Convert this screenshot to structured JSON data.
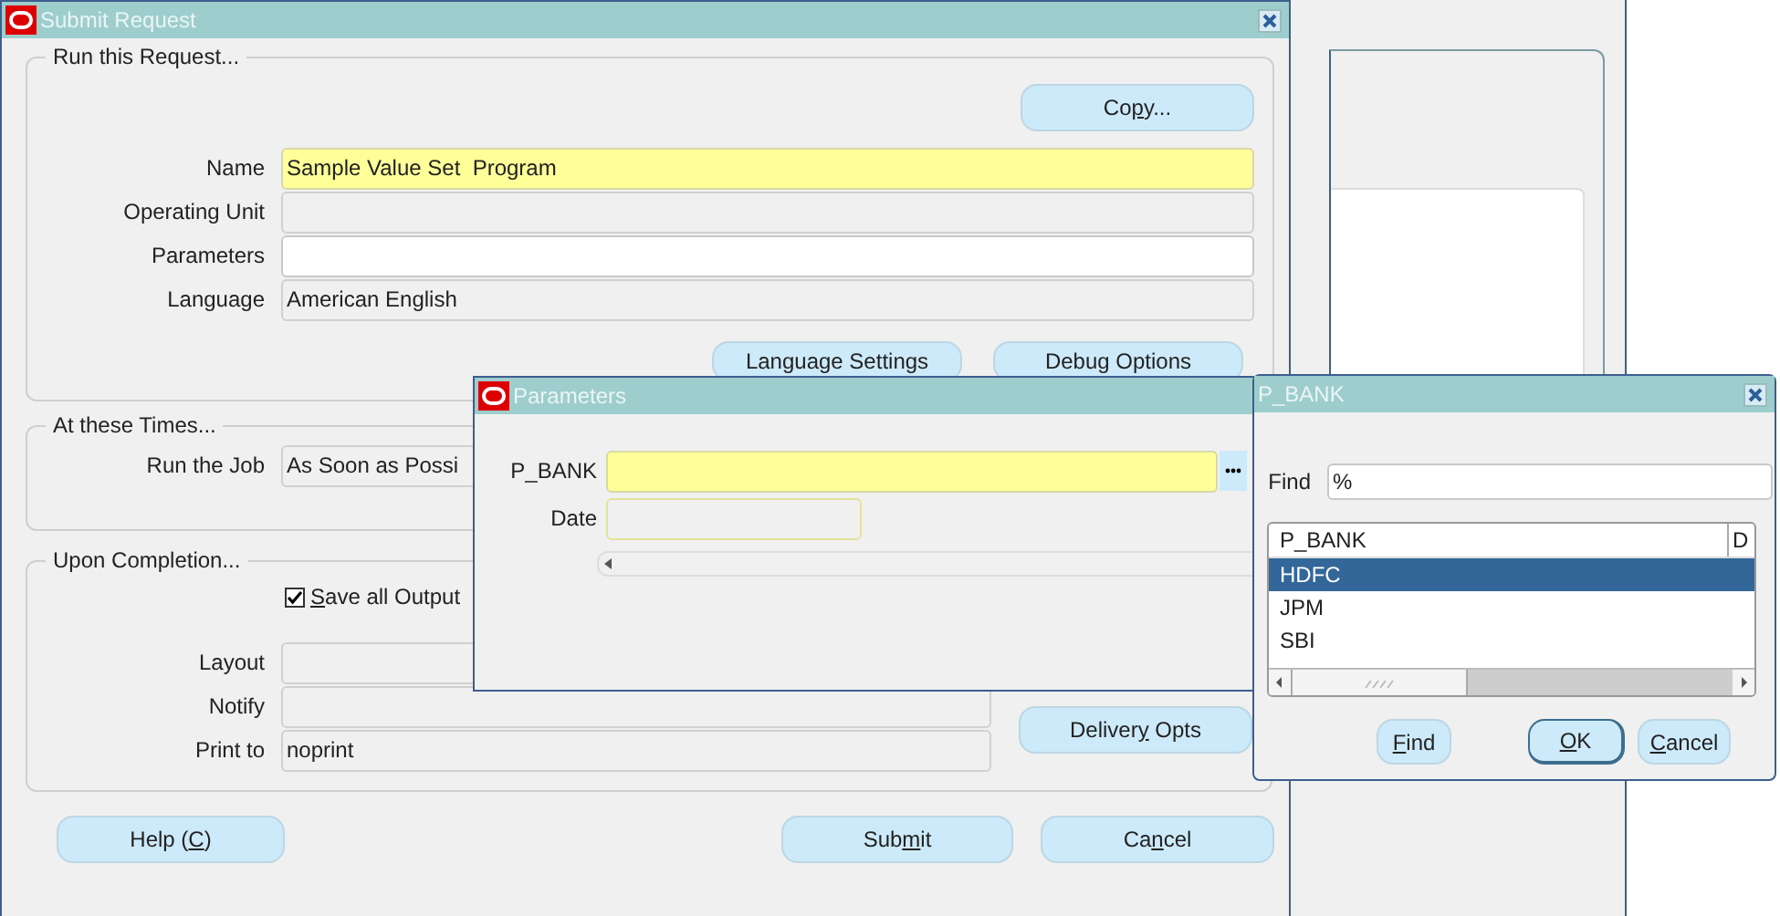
{
  "submit_request": {
    "title": "Submit Request",
    "run_this_request": {
      "legend": "Run this Request...",
      "copy_button": {
        "label_start": "Co",
        "access_key": "p",
        "label_end": "y..."
      },
      "fields": [
        {
          "label": "Name",
          "value": "Sample Value Set  Program",
          "kind": "required"
        },
        {
          "label": "Operating Unit",
          "kind": "readonly"
        },
        {
          "label": "Parameters",
          "kind": "editable"
        },
        {
          "label": "Language",
          "value": "American English",
          "kind": "readonly"
        }
      ],
      "buttons": [
        {
          "label": "Language Settings"
        },
        {
          "label": "Debug Options"
        }
      ]
    },
    "at_these_times": {
      "legend": "At these Times...",
      "run_the_job": {
        "label": "Run the Job",
        "value": "As Soon as Possi",
        "kind": "readonly"
      }
    },
    "upon_completion": {
      "legend": "Upon Completion...",
      "save_all_output": {
        "access_key": "S",
        "label_end": "ave all Output",
        "checked": true
      },
      "fields": [
        {
          "label": "Layout",
          "kind": "readonly"
        },
        {
          "label": "Notify",
          "kind": "readonly"
        },
        {
          "label": "Print to",
          "value": "noprint",
          "kind": "readonly"
        }
      ],
      "delivery_button": {
        "label_start": "Deliver",
        "access_key": "y",
        "label_end": " Opts"
      }
    },
    "buttons": [
      {
        "label_start": "Help (",
        "access_key": "C",
        "label_end": ")"
      },
      {
        "label_start": "Sub",
        "access_key": "m",
        "label_end": "it"
      },
      {
        "label_start": "Ca",
        "access_key": "n",
        "label_end": "cel"
      }
    ]
  },
  "parameters": {
    "title": "Parameters",
    "fields": [
      {
        "label": "P_BANK",
        "kind": "lov"
      },
      {
        "label": "Date",
        "kind": "date"
      }
    ]
  },
  "p_bank": {
    "title": "P_BANK",
    "find": {
      "label": "Find",
      "value": "%"
    },
    "columns": [
      "P_BANK",
      "D"
    ],
    "rows": [
      {
        "value": "HDFC",
        "selected": true
      },
      {
        "value": "JPM",
        "selected": false
      },
      {
        "value": "SBI",
        "selected": false
      }
    ],
    "buttons": [
      {
        "access_key": "F",
        "label_end": "ind",
        "default": false
      },
      {
        "access_key": "O",
        "label_end": "K",
        "default": true
      },
      {
        "access_key": "C",
        "label_end": "ancel",
        "default": false
      }
    ]
  }
}
